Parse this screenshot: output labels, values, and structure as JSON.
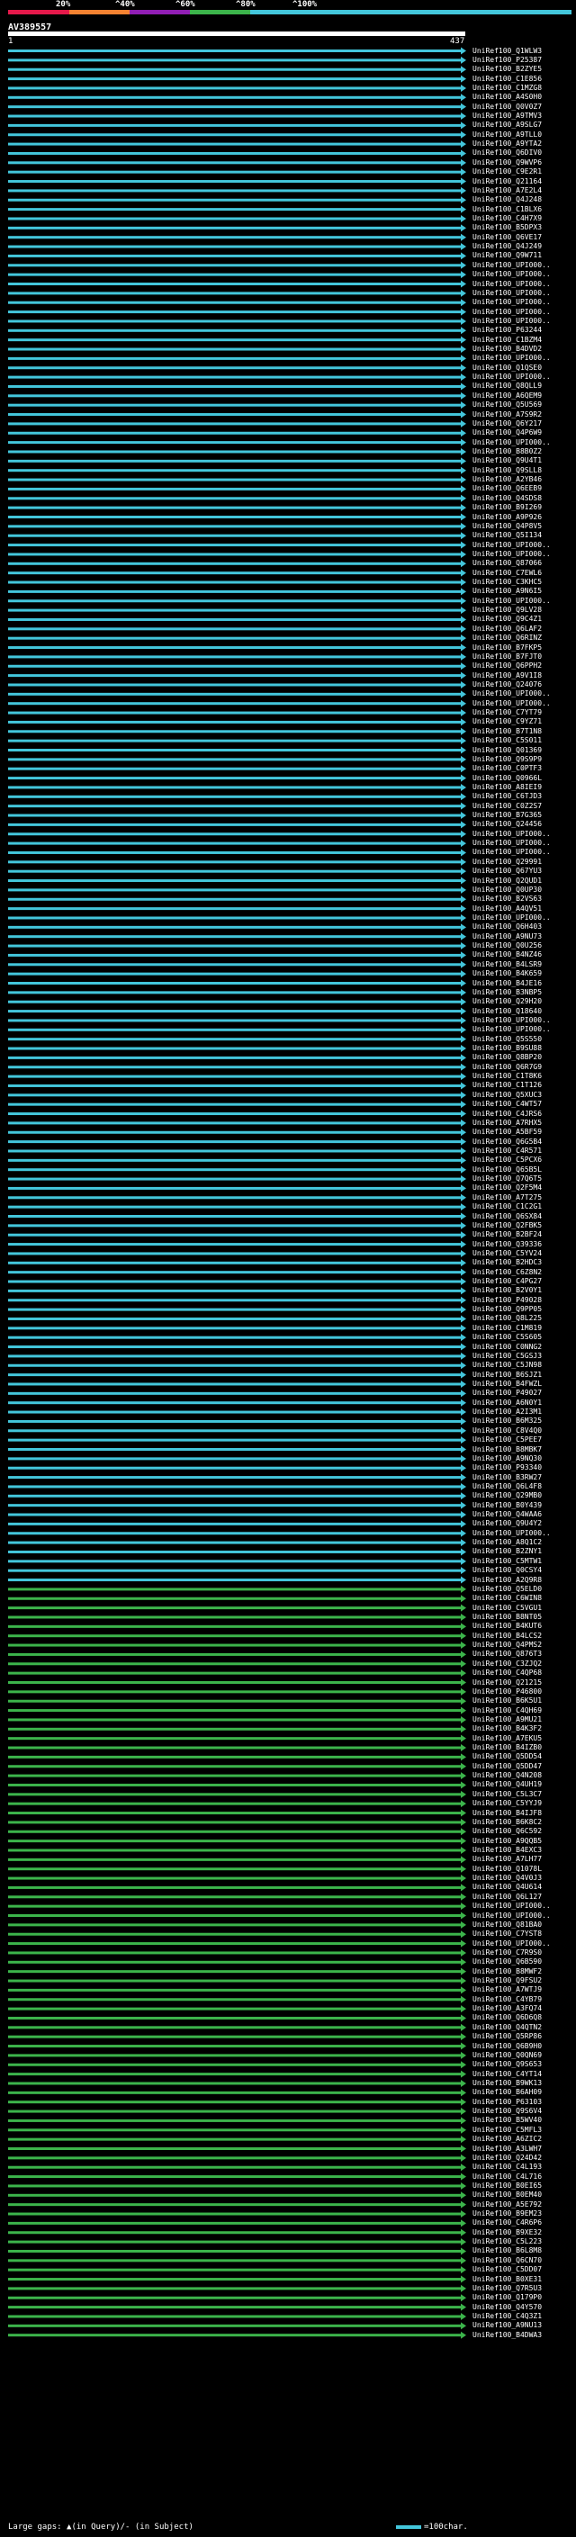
{
  "query_id": "AV389557",
  "start_tick": "1",
  "end_tick": "437",
  "legend": {
    "labels": [
      "20%",
      "^40%",
      "^60%",
      "^80%",
      "^100%"
    ],
    "colors": [
      "#e6194b",
      "#f58231",
      "#911eb4",
      "#3cb44b",
      "#43c6db"
    ]
  },
  "footer": {
    "large_gaps": "Large gaps: ▲(in Query)/- (in Subject)",
    "scale": "=100char."
  },
  "hits": [
    "UniRef100_Q1WLW3",
    "UniRef100_P25387",
    "UniRef100_B2ZYE5",
    "UniRef100_C1E856",
    "UniRef100_C1MZG8",
    "UniRef100_A4S0H0",
    "UniRef100_Q0V0Z7",
    "UniRef100_A9TMV3",
    "UniRef100_A9SLG7",
    "UniRef100_A9TLL0",
    "UniRef100_A9YTA2",
    "UniRef100_Q6DIV0",
    "UniRef100_Q9WVP6",
    "UniRef100_C9E2R1",
    "UniRef100_Q21164",
    "UniRef100_A7E2L4",
    "UniRef100_Q4J248",
    "UniRef100_C1BLX6",
    "UniRef100_C4H7X9",
    "UniRef100_B5DPX3",
    "UniRef100_Q6VE17",
    "UniRef100_Q4J249",
    "UniRef100_Q9W711",
    "UniRef100_UPI000..",
    "UniRef100_UPI000..",
    "UniRef100_UPI000..",
    "UniRef100_UPI000..",
    "UniRef100_UPI000..",
    "UniRef100_UPI000..",
    "UniRef100_UPI000..",
    "UniRef100_P63244",
    "UniRef100_C1BZM4",
    "UniRef100_B4DVD2",
    "UniRef100_UPI000..",
    "UniRef100_Q1QSE0",
    "UniRef100_UPI000..",
    "UniRef100_Q8QLL9",
    "UniRef100_A6QEM9",
    "UniRef100_Q5U569",
    "UniRef100_A7S9R2",
    "UniRef100_Q6Y217",
    "UniRef100_Q4P6W9",
    "UniRef100_UPI000..",
    "UniRef100_B8B0Z2",
    "UniRef100_Q9U4T1",
    "UniRef100_Q9SLL8",
    "UniRef100_A2YB46",
    "UniRef100_Q6EEB9",
    "UniRef100_Q4SDS8",
    "UniRef100_B9I269",
    "UniRef100_A9P926",
    "UniRef100_Q4P8V5",
    "UniRef100_Q5I134",
    "UniRef100_UPI000..",
    "UniRef100_UPI000..",
    "UniRef100_Q87066",
    "UniRef100_C7EWL6",
    "UniRef100_C3KHC5",
    "UniRef100_A9N6I5",
    "UniRef100_UPI000..",
    "UniRef100_Q9LV28",
    "UniRef100_Q9C4Z1",
    "UniRef100_Q6LAF2",
    "UniRef100_Q6RINZ",
    "UniRef100_B7FKP5",
    "UniRef100_B7FJT0",
    "UniRef100_Q6PPH2",
    "UniRef100_A9V1I8",
    "UniRef100_Q24076",
    "UniRef100_UPI000..",
    "UniRef100_UPI000..",
    "UniRef100_C7YT79",
    "UniRef100_C9YZ71",
    "UniRef100_B7T1N8",
    "UniRef100_C5S011",
    "UniRef100_Q01369",
    "UniRef100_Q9S9P9",
    "UniRef100_C0PTF3",
    "UniRef100_Q0966L",
    "UniRef100_A8IEI9",
    "UniRef100_C6TJD3",
    "UniRef100_C0Z2S7",
    "UniRef100_B7G365",
    "UniRef100_Q24456",
    "UniRef100_UPI000..",
    "UniRef100_UPI000..",
    "UniRef100_UPI000..",
    "UniRef100_Q29991",
    "UniRef100_Q67YU3",
    "UniRef100_Q2QUD1",
    "UniRef100_Q0UP30",
    "UniRef100_B2VS63",
    "UniRef100_A4QV51",
    "UniRef100_UPI000..",
    "UniRef100_Q6H403",
    "UniRef100_A9NU73",
    "UniRef100_Q0U256",
    "UniRef100_B4NZ46",
    "UniRef100_B4LSR9",
    "UniRef100_B4K659",
    "UniRef100_B4JE16",
    "UniRef100_B3NBP5",
    "UniRef100_Q29H20",
    "UniRef100_Q18640",
    "UniRef100_UPI000..",
    "UniRef100_UPI000..",
    "UniRef100_Q5S550",
    "UniRef100_B9SU88",
    "UniRef100_Q8BP20",
    "UniRef100_Q6R7G9",
    "UniRef100_C1T8K6",
    "UniRef100_C1T126",
    "UniRef100_Q5XUC3",
    "UniRef100_C4WT57",
    "UniRef100_C4JRS6",
    "UniRef100_A7RHX5",
    "UniRef100_A5BF59",
    "UniRef100_Q6G5B4",
    "UniRef100_C4R571",
    "UniRef100_C5PCX6",
    "UniRef100_Q65B5L",
    "UniRef100_Q7Q6T5",
    "UniRef100_Q2F5M4",
    "UniRef100_A7T275",
    "UniRef100_C1C2G1",
    "UniRef100_Q6SX84",
    "UniRef100_Q2FBK5",
    "UniRef100_B2BF24",
    "UniRef100_Q39336",
    "UniRef100_C5YV24",
    "UniRef100_B2HDC3",
    "UniRef100_C6Z8N2",
    "UniRef100_C4PG27",
    "UniRef100_B2V0Y1",
    "UniRef100_P49028",
    "UniRef100_Q9PP05",
    "UniRef100_Q8L225",
    "UniRef100_C1M819",
    "UniRef100_C5S605",
    "UniRef100_C0NNG2",
    "UniRef100_C5GSJ3",
    "UniRef100_C5JN98",
    "UniRef100_B6SJZ1",
    "UniRef100_B4FWZL",
    "UniRef100_P49027",
    "UniRef100_A6N0Y1",
    "UniRef100_A2I3M1",
    "UniRef100_B6M325",
    "UniRef100_C8V4Q0",
    "UniRef100_C5PEE7",
    "UniRef100_B8MBK7",
    "UniRef100_A9NQ30",
    "UniRef100_P93340",
    "UniRef100_B3RW27",
    "UniRef100_Q6L4F8",
    "UniRef100_Q29MB0",
    "UniRef100_B0Y439",
    "UniRef100_Q4WAA6",
    "UniRef100_Q9U4Y2",
    "UniRef100_UPI000..",
    "UniRef100_A8Q1C2",
    "UniRef100_B2ZNY1",
    "UniRef100_C5MTW1",
    "UniRef100_Q0CSY4",
    "UniRef100_A2Q9R8",
    "UniRef100_Q5ELD0",
    "UniRef100_C6WIN8",
    "UniRef100_C5VGU1",
    "UniRef100_B8NT05",
    "UniRef100_B4KUT6",
    "UniRef100_B4LCS2",
    "UniRef100_Q4PMS2",
    "UniRef100_Q876T3",
    "UniRef100_C3ZJQ2",
    "UniRef100_C4QP68",
    "UniRef100_Q21215",
    "UniRef100_P46800",
    "UniRef100_B6K5U1",
    "UniRef100_C4QH69",
    "UniRef100_A9MU21",
    "UniRef100_B4K3F2",
    "UniRef100_A7EKU5",
    "UniRef100_B4IZB0",
    "UniRef100_Q5DD54",
    "UniRef100_Q5DD47",
    "UniRef100_Q4N208",
    "UniRef100_Q4UH19",
    "UniRef100_C5L3C7",
    "UniRef100_C5YYJ9",
    "UniRef100_B4IJF8",
    "UniRef100_B6K8C2",
    "UniRef100_Q6C592",
    "UniRef100_A9QQB5",
    "UniRef100_B4EXC3",
    "UniRef100_A7LH77",
    "UniRef100_Q1078L",
    "UniRef100_Q4V0J3",
    "UniRef100_Q4U614",
    "UniRef100_Q6L127",
    "UniRef100_UPI000..",
    "UniRef100_UPI000..",
    "UniRef100_Q81BA0",
    "UniRef100_C7YST8",
    "UniRef100_UPI000..",
    "UniRef100_C7R9S0",
    "UniRef100_Q6B590",
    "UniRef100_B8MWF2",
    "UniRef100_Q9FSU2",
    "UniRef100_A7WTJ9",
    "UniRef100_C4YB79",
    "UniRef100_A3FQ74",
    "UniRef100_Q6D6Q8",
    "UniRef100_Q4QTN2",
    "UniRef100_Q5RP86",
    "UniRef100_Q6B9H0",
    "UniRef100_Q0QN69",
    "UniRef100_Q9S653",
    "UniRef100_C4YT14",
    "UniRef100_B9WK13",
    "UniRef100_B6AH09",
    "UniRef100_P63103",
    "UniRef100_Q9S6V4",
    "UniRef100_B5WV40",
    "UniRef100_C5MFL3",
    "UniRef100_A6ZIC2",
    "UniRef100_A3LWH7",
    "UniRef100_Q24D42",
    "UniRef100_C4L193",
    "UniRef100_C4L716",
    "UniRef100_B0EI65",
    "UniRef100_B0EM40",
    "UniRef100_A5E792",
    "UniRef100_B9EM23",
    "UniRef100_C4R6P6",
    "UniRef100_B9XE32",
    "UniRef100_C5L223",
    "UniRef100_B6L8M8",
    "UniRef100_Q6CN70",
    "UniRef100_C5DD07",
    "UniRef100_B0XE31",
    "UniRef100_Q7R5U3",
    "UniRef100_Q179P0",
    "UniRef100_Q4Y570",
    "UniRef100_C4Q3Z1",
    "UniRef100_A9NU13",
    "UniRef100_B4DWA3"
  ]
}
